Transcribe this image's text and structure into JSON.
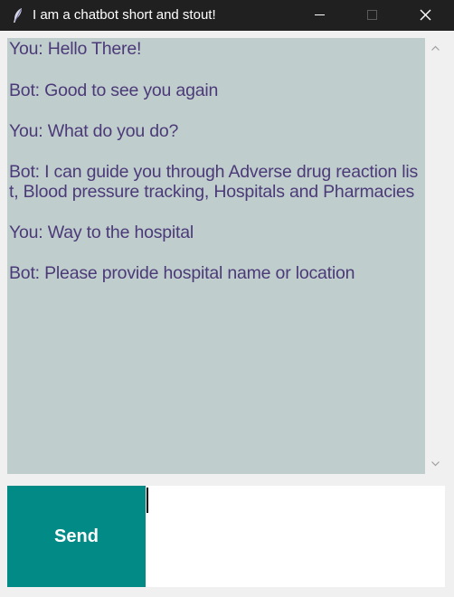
{
  "window": {
    "title": "I am a chatbot short and stout!",
    "icon": "feather-icon",
    "controls": [
      "minimize-icon",
      "maximize-icon",
      "close-icon"
    ]
  },
  "chat": {
    "lines": [
      "You: Hello There!",
      "Bot: Good to see you again",
      "You: What do you do?",
      "Bot: I can guide you through Adverse drug reaction lis",
      "t, Blood pressure tracking, Hospitals and Pharmacies",
      "You: Way to the hospital",
      "Bot: Please provide hospital name or location"
    ]
  },
  "composer": {
    "send_label": "Send",
    "input_value": ""
  },
  "colors": {
    "titlebar": "#202020",
    "chat_background": "#c0cdcd",
    "chat_text": "#4b3a78",
    "send_button": "#028a86",
    "window_background": "#f0f0f0"
  }
}
